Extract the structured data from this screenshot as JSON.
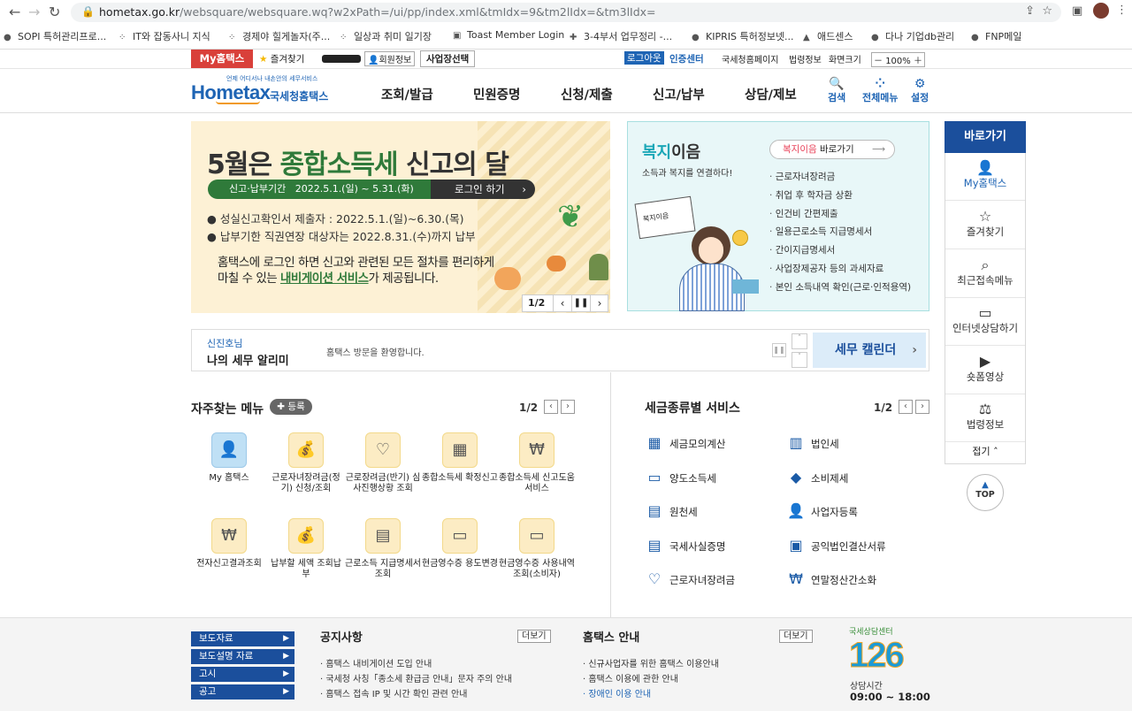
{
  "browser": {
    "url_host": "hometax.go.kr",
    "url_path": "/websquare/websquare.wq?w2xPath=/ui/pp/index.xml&tmIdx=9&tm2lIdx=&tm3lIdx=",
    "bookmarks": [
      "SOPI 특허관리프로...",
      "IT와 잡동사니 지식",
      "경제야 힐게놀자(주...",
      "일상과 취미 일기장",
      "Toast Member Login",
      "3-4부서 업무정리 -...",
      "KIPRIS 특허정보넷...",
      "애드센스",
      "다나 기업db관리",
      "FNP메일"
    ]
  },
  "topstrip": {
    "my_hometax": "My홈택스",
    "favorites": "즐겨찾기",
    "member_info": "회원정보",
    "biz_select": "사업장선택",
    "logout": "로그아웃",
    "cert_center": "인증센터",
    "nts_home": "국세청홈페이지",
    "law_info": "법령정보",
    "zoom_label": "화면크기",
    "zoom": "100%"
  },
  "header": {
    "logo_small": "언제 어디서나 내손안의 세무서비스",
    "logo_main": "Hometax",
    "logo_sub": "국세청홈택스",
    "menu": [
      "조회/발급",
      "민원증명",
      "신청/제출",
      "신고/납부",
      "상담/제보"
    ],
    "search": "검색",
    "all_menu": "전체메뉴",
    "settings": "설정"
  },
  "banner": {
    "headline_pre": "5월은 ",
    "headline_hi": "종합소득세",
    "headline_post": " 신고의 달",
    "period": "신고·납부기간   2022.5.1.(일) ~ 5.31.(화)",
    "login_btn": "로그인 하기",
    "bullet1": "성실신고확인서 제출자 : 2022.5.1.(일)~6.30.(목)",
    "bullet2": "납부기한 직권연장 대상자는 2022.8.31.(수)까지 납부",
    "body1": "홈택스에 로그인 하면 신고와 관련된 모든 절차를 편리하게",
    "body2_pre": "마칠 수 있는 ",
    "body2_link": "내비게이션 서비스",
    "body2_post": "가 제공됩니다.",
    "page": "1/2"
  },
  "welfare": {
    "title_a": "복지",
    "title_b": "이음",
    "subtitle": "소득과 복지를 연결하다!",
    "go_a": "복지이음",
    "go_b": " 바로가기",
    "items": [
      "근로자녀장려금",
      "취업 후 학자금 상환",
      "인건비 간편제출",
      "일용근로소득 지급명세서",
      "간이지급명세서",
      "사업장제공자 등의 과세자료",
      "본인 소득내역 확인(근로·인적용역)"
    ],
    "sign_text": "복지이음"
  },
  "quick": {
    "title": "바로가기",
    "items": [
      "My홈택스",
      "즐겨찾기",
      "최근접속메뉴",
      "인터넷상담하기",
      "숏폼영상",
      "법령정보"
    ],
    "fold": "접기",
    "top": "TOP"
  },
  "alarm": {
    "greeting": "신진호님",
    "title": "나의 세무 알리미",
    "message": "홈택스 방문을 환영합니다.",
    "calendar": "세무 캘린더"
  },
  "favmenu": {
    "title": "자주찾는 메뉴",
    "add": "등록",
    "page": "1/2",
    "items": [
      {
        "label": "My 홈택스",
        "icon": "user-icon"
      },
      {
        "label": "근로자녀장려금(정기) 신청/조회",
        "icon": "money-bag-icon"
      },
      {
        "label": "근로장려금(반기) 심사진행상황 조회",
        "icon": "heart-check-icon"
      },
      {
        "label": "종합소득세 확정신고",
        "icon": "calendar-icon"
      },
      {
        "label": "종합소득세 신고도움 서비스",
        "icon": "doc-won-icon"
      },
      {
        "label": "전자신고결과조회",
        "icon": "doc-won-icon"
      },
      {
        "label": "납부할 세액 조회납부",
        "icon": "money-bag-icon"
      },
      {
        "label": "근로소득 지급명세서 조회",
        "icon": "wallet-icon"
      },
      {
        "label": "현금영수증 용도변경",
        "icon": "cash-icon"
      },
      {
        "label": "현금영수증 사용내역조회(소비자)",
        "icon": "cash-icon"
      }
    ]
  },
  "taxservice": {
    "title": "세금종류별 서비스",
    "page": "1/2",
    "left": [
      "세금모의계산",
      "양도소득세",
      "원천세",
      "국세사실증명",
      "근로자녀장려금"
    ],
    "right": [
      "법인세",
      "소비제세",
      "사업자등록",
      "공익법인결산서류",
      "연말정산간소화"
    ]
  },
  "footer": {
    "buttons": [
      "보도자료",
      "보도설명 자료",
      "고시",
      "공고"
    ],
    "notice_title": "공지사항",
    "notice_more": "더보기",
    "notices": [
      "홈택스 내비게이션 도입 안내",
      "국세청 사칭「종소세 환급금 안내」문자 주의 안내",
      "홈택스 접속 IP 및 시간 확인 관련 안내"
    ],
    "guide_title": "홈택스 안내",
    "guide_more": "더보기",
    "guides": [
      "신규사업자를 위한 홈택스 이용안내",
      "홈택스 이용에 관한 안내",
      "장애인 이용 안내"
    ],
    "center_label": "국세상담센터",
    "center_num": "126",
    "hours_label": "상담시간",
    "hours": "09:00 ~ 18:00"
  },
  "colors": {
    "brand": "#1e64b4",
    "banner_green": "#2f7a3a",
    "footer_blue": "#1b4f9c"
  }
}
